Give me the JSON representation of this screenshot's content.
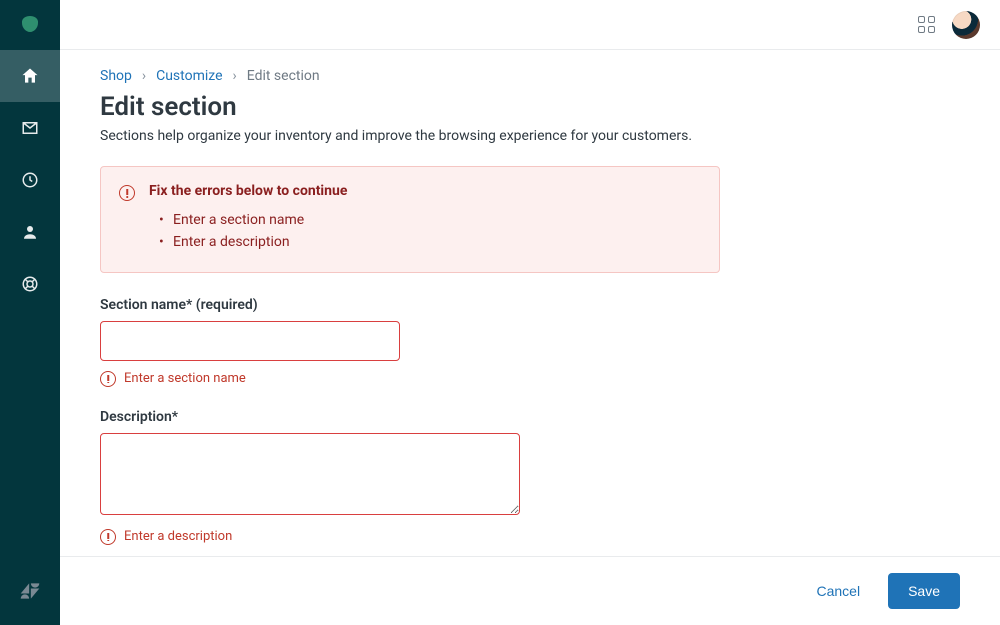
{
  "breadcrumb": {
    "items": [
      {
        "label": "Shop",
        "link": true
      },
      {
        "label": "Customize",
        "link": true
      },
      {
        "label": "Edit section",
        "link": false
      }
    ]
  },
  "page": {
    "title": "Edit section",
    "subtitle": "Sections help organize your inventory and improve the browsing experience for your customers."
  },
  "alert": {
    "title": "Fix the errors below to continue",
    "items": [
      "Enter a section name",
      "Enter a description"
    ]
  },
  "fields": {
    "section_name": {
      "label": "Section name* (required)",
      "value": "",
      "error": "Enter a section name"
    },
    "description": {
      "label": "Description*",
      "value": "",
      "error": "Enter a description"
    }
  },
  "footer": {
    "cancel": "Cancel",
    "save": "Save"
  }
}
